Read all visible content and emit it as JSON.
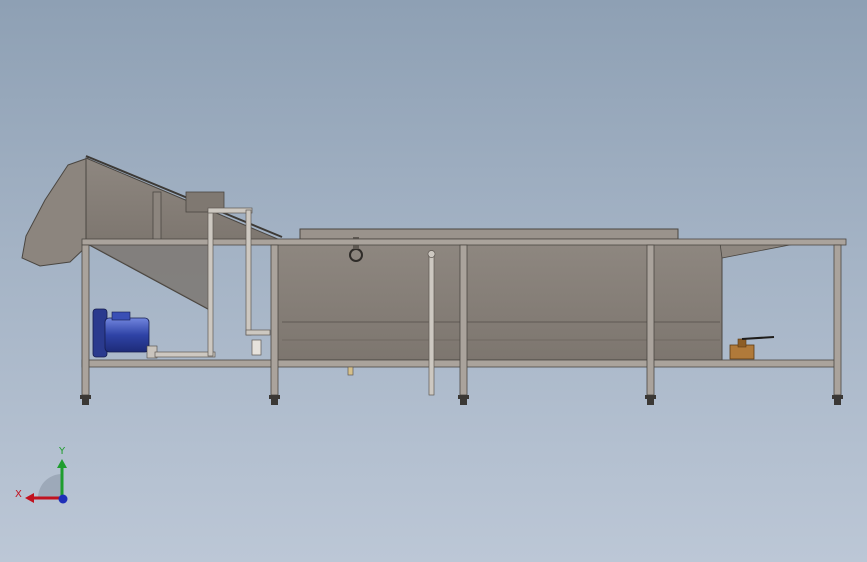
{
  "viewport": {
    "background_top": "#8ea0b4",
    "background_bottom": "#bcc7d6"
  },
  "model": {
    "description_semantic": "side-view-cad-model-washing-machine",
    "colors": {
      "steel": "#8a837c",
      "steel_dark": "#5f5953",
      "frame": "#a9a39c",
      "frame_edge": "#4a4641",
      "pipe": "#c9c4bd",
      "motor": "#2d3f9e",
      "motor_light": "#6e82d8",
      "valve": "#b07a3a"
    }
  },
  "triad": {
    "x_label": "X",
    "y_label": "Y",
    "x_color": "#c1121f",
    "y_color": "#1f9d2e",
    "z_color": "#1f2fb8"
  }
}
